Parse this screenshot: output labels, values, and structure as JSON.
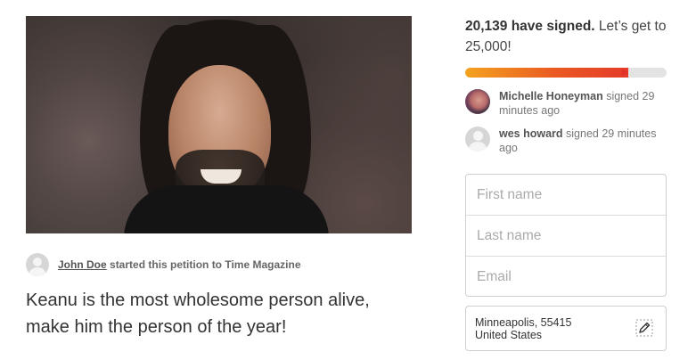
{
  "petition": {
    "image_alt": "Keanu Reeves smiling",
    "starter": {
      "name": "John Doe",
      "action_text": "started this petition to Time Magazine"
    },
    "headline": "Keanu is the most wholesome person alive, make him the person of the year!"
  },
  "signatures": {
    "count_text": "20,139 have signed.",
    "goal_text": "Let’s get to 25,000!",
    "progress_fraction": 0.81,
    "colors": {
      "bar_start": "#f4a21e",
      "bar_end": "#e53a2a",
      "track": "#e3e3e3"
    }
  },
  "recent_signers": [
    {
      "name": "Michelle Honeyman",
      "action": "signed 29 minutes ago",
      "avatar": "photo"
    },
    {
      "name": "wes howard",
      "action": "signed 29 minutes ago",
      "avatar": "placeholder-person-icon"
    }
  ],
  "form": {
    "first_name": {
      "placeholder": "First name",
      "value": ""
    },
    "last_name": {
      "placeholder": "Last name",
      "value": ""
    },
    "email": {
      "placeholder": "Email",
      "value": ""
    },
    "location": {
      "line1": "Minneapolis, 55415",
      "line2": "United States",
      "edit_icon": "pencil-edit-icon"
    }
  }
}
